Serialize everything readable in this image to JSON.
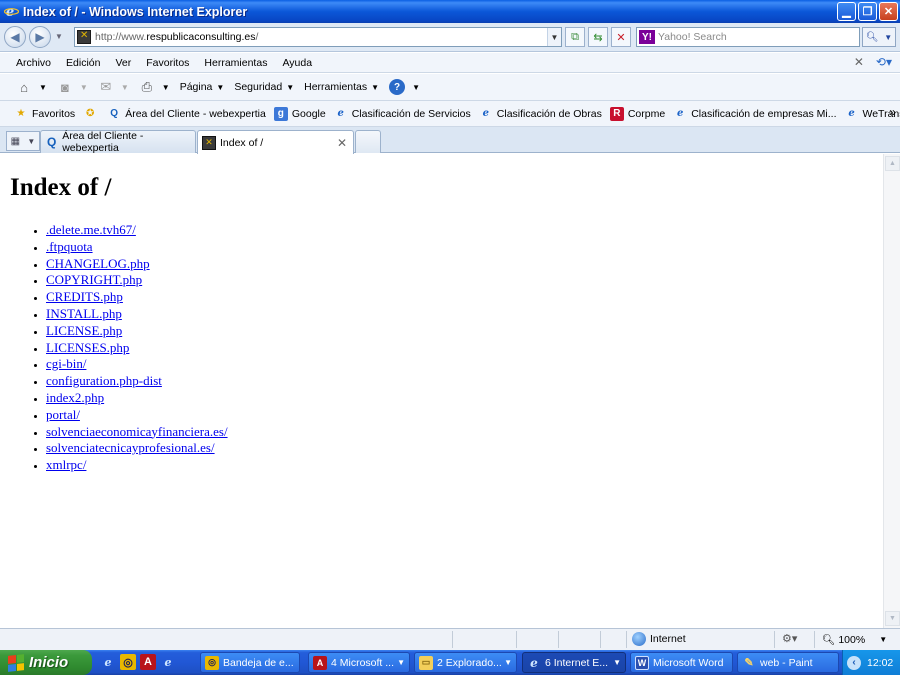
{
  "window": {
    "title": "Index of / - Windows Internet Explorer"
  },
  "address_bar": {
    "url_prefix": "http://www.",
    "url_host": "respublicaconsulting.es",
    "url_suffix": "/",
    "search_placeholder": "Yahoo! Search"
  },
  "menu": [
    "Archivo",
    "Edición",
    "Ver",
    "Favoritos",
    "Herramientas",
    "Ayuda"
  ],
  "command_bar": {
    "page": "Página",
    "safety": "Seguridad",
    "tools": "Herramientas"
  },
  "favorites_bar": {
    "favorites_label": "Favoritos",
    "links": [
      {
        "label": "Área del Cliente - webexpertia",
        "icon": "q-icon"
      },
      {
        "label": "Google",
        "icon": "google-icon"
      },
      {
        "label": "Clasificación de Servicios",
        "icon": "ie-page-icon"
      },
      {
        "label": "Clasificación de Obras",
        "icon": "ie-page-icon"
      },
      {
        "label": "Corpme",
        "icon": "corpme-icon"
      },
      {
        "label": "Clasificación de empresas Mi...",
        "icon": "ie-page-icon"
      },
      {
        "label": "WeTransfer",
        "icon": "ie-page-icon"
      }
    ]
  },
  "tabs": [
    {
      "label": "Área del Cliente - webexpertia",
      "active": false
    },
    {
      "label": "Index of /",
      "active": true
    }
  ],
  "page": {
    "heading": "Index of /",
    "entries": [
      ".delete.me.tvh67/",
      ".ftpquota",
      "CHANGELOG.php",
      "COPYRIGHT.php",
      "CREDITS.php",
      "INSTALL.php",
      "LICENSE.php",
      "LICENSES.php",
      "cgi-bin/",
      "configuration.php-dist",
      "index2.php",
      "portal/",
      "solvenciaeconomicayfinanciera.es/",
      "solvenciatecnicayprofesional.es/",
      "xmlrpc/"
    ]
  },
  "status_bar": {
    "zone": "Internet",
    "zoom": "100%"
  },
  "taskbar": {
    "start_label": "Inicio",
    "buttons": [
      {
        "label": "Bandeja de e...",
        "active": false,
        "grouped": false
      },
      {
        "label": "4 Microsoft ...",
        "active": false,
        "grouped": true
      },
      {
        "label": "2 Explorado...",
        "active": false,
        "grouped": true
      },
      {
        "label": "6 Internet E...",
        "active": true,
        "grouped": true
      },
      {
        "label": "Microsoft Word",
        "active": false,
        "grouped": false
      },
      {
        "label": "web - Paint",
        "active": false,
        "grouped": false
      }
    ],
    "clock": "12:02"
  },
  "colors": {
    "link": "#0000ee",
    "titlebar": "#0b57d8",
    "taskbar": "#2157d5",
    "start": "#3c9a3c"
  }
}
